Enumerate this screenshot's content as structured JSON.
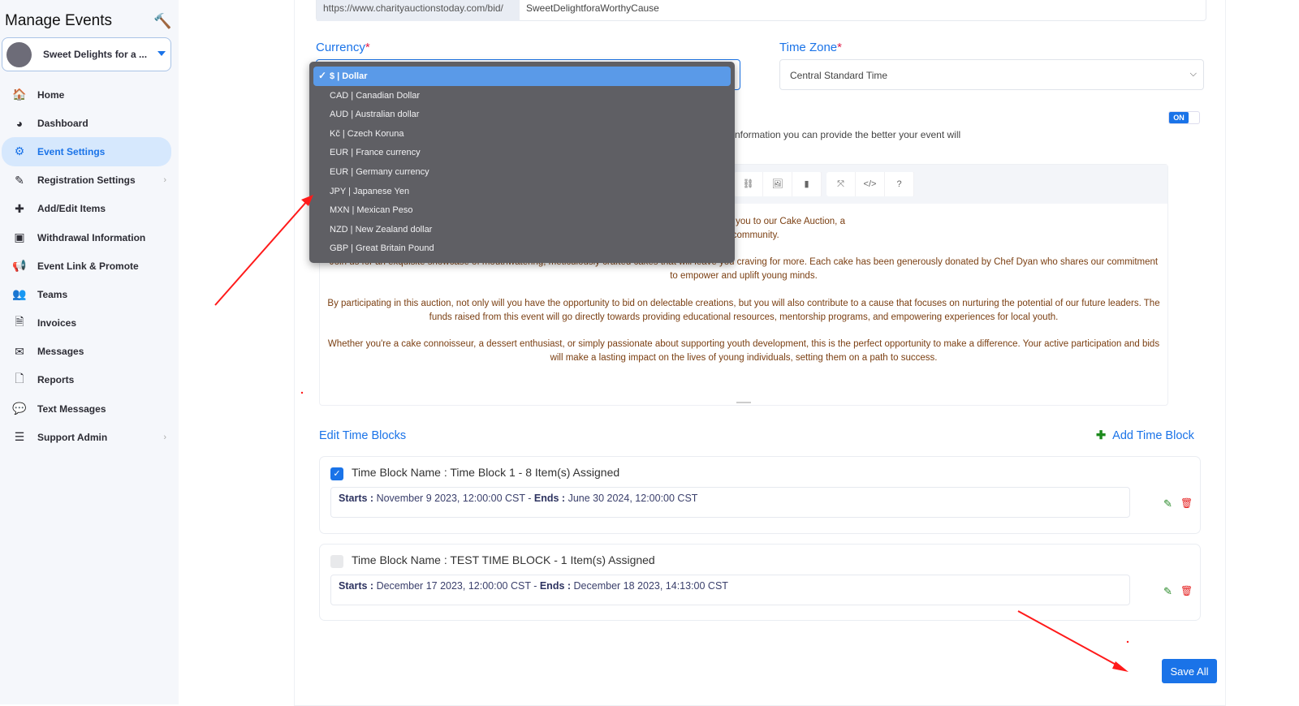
{
  "sidebar": {
    "title": "Manage Events",
    "event_name": "Sweet Delights for a ...",
    "items": [
      {
        "label": "Home",
        "icon": "🏠",
        "name": "home"
      },
      {
        "label": "Dashboard",
        "icon": "◕",
        "name": "dashboard"
      },
      {
        "label": "Event Settings",
        "icon": "⚙",
        "name": "event-settings",
        "active": true
      },
      {
        "label": "Registration Settings",
        "icon": "✎",
        "name": "registration-settings",
        "chevron": true
      },
      {
        "label": "Add/Edit Items",
        "icon": "✚",
        "name": "add-edit-items"
      },
      {
        "label": "Withdrawal Information",
        "icon": "▣",
        "name": "withdrawal-information"
      },
      {
        "label": "Event Link & Promote",
        "icon": "📢",
        "name": "event-link-promote"
      },
      {
        "label": "Teams",
        "icon": "👥",
        "name": "teams"
      },
      {
        "label": "Invoices",
        "icon": "🗎",
        "name": "invoices"
      },
      {
        "label": "Messages",
        "icon": "✉",
        "name": "messages"
      },
      {
        "label": "Reports",
        "icon": "🗋",
        "name": "reports"
      },
      {
        "label": "Text Messages",
        "icon": "💬",
        "name": "text-messages"
      },
      {
        "label": "Support Admin",
        "icon": "☰",
        "name": "support-admin",
        "chevron": true
      }
    ]
  },
  "url": {
    "prefix": "https://www.charityauctionstoday.com/bid/",
    "value": "SweetDelightforaWorthyCause"
  },
  "currency": {
    "label": "Currency",
    "required": "*",
    "selected": "$ | Dollar",
    "options": [
      "$ | Dollar",
      "CAD | Canadian Dollar",
      "AUD | Australian dollar",
      "Kč | Czech Koruna",
      "EUR | France currency",
      "EUR | Germany currency",
      "JPY | Japanese Yen",
      "MXN | Mexican Peso",
      "NZD | New Zealand dollar",
      "GBP | Great Britain Pound"
    ]
  },
  "timezone": {
    "label": "Time Zone",
    "required": "*",
    "value": "Central Standard Time"
  },
  "toggle": {
    "label": "ON",
    "state": true
  },
  "hint": "nformation you can provide the better your event will",
  "editor": {
    "toolbar": [
      "link-icon",
      "image-icon",
      "video-icon",
      "fullscreen-icon",
      "code-view-icon",
      "help-icon"
    ],
    "toolbar_glyphs": [
      "⛓",
      "🖼",
      "▮",
      "⤧",
      "</>",
      "?"
    ],
    "paragraphs": [
      "ve are thrilled to invite you to our Cake Auction, a\nn our community.",
      "Join us for an exquisite showcase of mouthwatering, meticulously crafted cakes that will leave you craving for more. Each cake has been generously donated by Chef Dyan who shares our commitment to empower and uplift young minds.",
      "By participating in this auction, not only will you have the opportunity to bid on delectable creations, but you will also contribute to a cause that focuses on nurturing the potential of our future leaders. The funds raised from this event will go directly towards providing educational resources, mentorship programs, and empowering experiences for local youth.",
      "Whether you're a cake connoisseur, a dessert enthusiast, or simply passionate about supporting youth development, this is the perfect opportunity to make a difference. Your active participation and bids will make a lasting impact on the lives of young individuals, setting them on a path to success."
    ]
  },
  "time_blocks": {
    "title": "Edit Time Blocks",
    "add_label": "Add Time Block",
    "name_label": "Time Block Name :",
    "starts_label": "Starts :",
    "ends_label": "Ends :",
    "items": [
      {
        "name": "Time Block 1 - 8 Item(s) Assigned",
        "checked": true,
        "starts": "November 9 2023, 12:00:00 CST",
        "ends": "June 30 2024, 12:00:00 CST"
      },
      {
        "name": "TEST TIME BLOCK - 1 Item(s) Assigned",
        "checked": false,
        "starts": "December 17 2023, 12:00:00 CST",
        "ends": "December 18 2023, 14:13:00 CST"
      }
    ]
  },
  "save_label": "Save All",
  "colors": {
    "accent": "#1a73e8",
    "annotation": "#ff1a1a",
    "dropdown_bg": "#5f5f64",
    "dropdown_selected": "#5a9ae8",
    "editor_text": "#7b3f12"
  }
}
